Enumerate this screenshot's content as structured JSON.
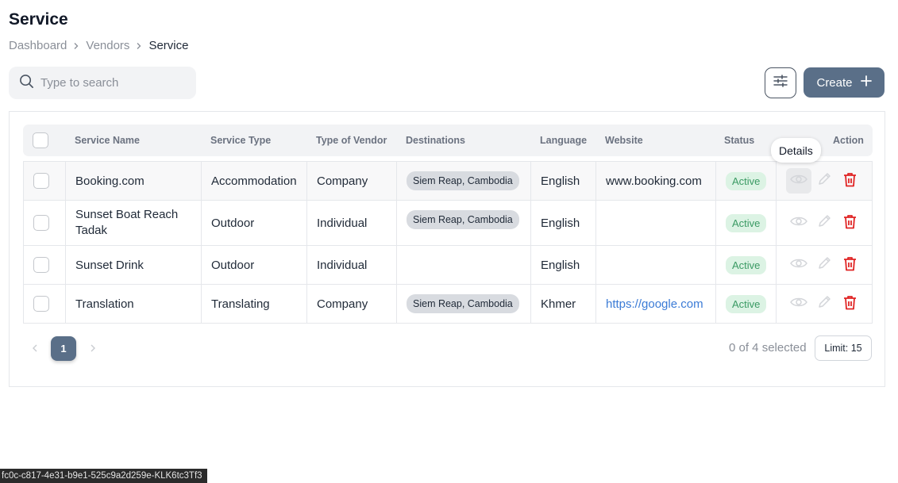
{
  "page": {
    "title": "Service"
  },
  "breadcrumb": [
    "Dashboard",
    "Vendors",
    "Service"
  ],
  "search": {
    "placeholder": "Type to search",
    "value": ""
  },
  "toolbar": {
    "create_label": "Create"
  },
  "table": {
    "headers": {
      "service_name": "Service Name",
      "service_type": "Service Type",
      "vendor_type": "Type of Vendor",
      "destinations": "Destinations",
      "language": "Language",
      "website": "Website",
      "status": "Status",
      "action": "Action"
    },
    "rows": [
      {
        "service_name": [
          "Booking.com"
        ],
        "service_type": "Accommodation",
        "vendor_type": "Company",
        "destination": "Siem Reap, Cambodia",
        "language": "English",
        "website": "www.booking.com",
        "status": "Active"
      },
      {
        "service_name": [
          "Sunset Boat Reach",
          "Tadak"
        ],
        "service_type": "Outdoor",
        "vendor_type": "Individual",
        "destination": "Siem Reap, Cambodia",
        "language": "English",
        "website": "",
        "status": "Active"
      },
      {
        "service_name": [
          "Sunset Drink"
        ],
        "service_type": "Outdoor",
        "vendor_type": "Individual",
        "destination": "",
        "language": "English",
        "website": "",
        "status": "Active"
      },
      {
        "service_name": [
          "Translation"
        ],
        "service_type": "Translating",
        "vendor_type": "Company",
        "destination": "Siem Reap, Cambodia",
        "language": "Khmer",
        "website": "https://google.com",
        "status": "Active"
      }
    ]
  },
  "tooltip": {
    "text": "Details"
  },
  "pagination": {
    "current_page": "1",
    "selected_text": "0 of 4 selected",
    "limit_label": "Limit: 15"
  },
  "footer": {
    "id_text": "fc0c-c817-4e31-b9e1-525c9a2d259e-KLK6tc3Tf3"
  },
  "colors": {
    "primary": "#5a6f88",
    "active_bg": "#dcf3e4",
    "active_text": "#3a9a63",
    "delete": "#e02424",
    "link": "#3b7bd6"
  },
  "icons": {
    "search": "search-icon",
    "filter": "sliders-icon",
    "create": "plus-icon",
    "view": "eye-icon",
    "edit": "pencil-icon",
    "delete": "trash-icon",
    "breadcrumb_sep": "chevron-right-icon"
  }
}
